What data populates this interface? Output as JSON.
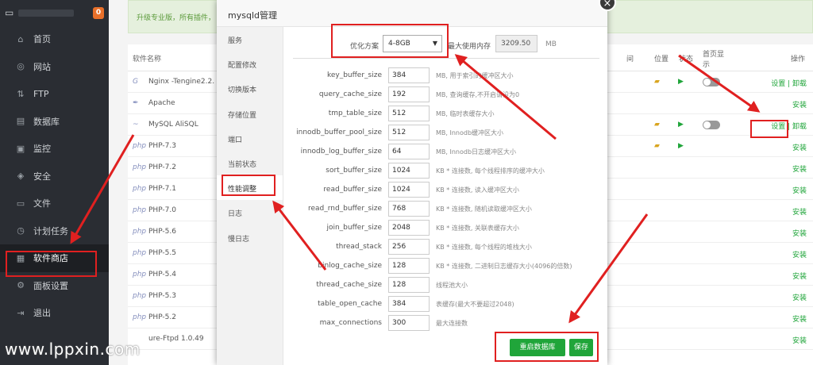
{
  "sidebar": {
    "badge": "0",
    "items": [
      {
        "label": "首页",
        "icon": "home-icon",
        "glyph": "⌂"
      },
      {
        "label": "网站",
        "icon": "globe-icon",
        "glyph": "◎"
      },
      {
        "label": "FTP",
        "icon": "ftp-icon",
        "glyph": "⇅"
      },
      {
        "label": "数据库",
        "icon": "database-icon",
        "glyph": "▤"
      },
      {
        "label": "监控",
        "icon": "monitor-icon",
        "glyph": "▣"
      },
      {
        "label": "安全",
        "icon": "shield-icon",
        "glyph": "◈"
      },
      {
        "label": "文件",
        "icon": "folder-icon",
        "glyph": "▭"
      },
      {
        "label": "计划任务",
        "icon": "clock-icon",
        "glyph": "◷"
      },
      {
        "label": "软件商店",
        "icon": "store-icon",
        "glyph": "▦"
      },
      {
        "label": "面板设置",
        "icon": "gear-icon",
        "glyph": "⚙"
      },
      {
        "label": "退出",
        "icon": "logout-icon",
        "glyph": "⇥"
      }
    ]
  },
  "promo": {
    "text": "升级专业版，所有插件，"
  },
  "table": {
    "headers": {
      "name": "软件名称",
      "time": "间",
      "pos": "位置",
      "status": "状态",
      "home1": "首页显",
      "home2": "示",
      "ops": "操作"
    },
    "rows": [
      {
        "logo": "G",
        "name": "Nginx -Tengine2.2.",
        "ops": "设置 | 卸载",
        "has_ctrl": true
      },
      {
        "logo": "✒",
        "name": "Apache",
        "ops": "安装",
        "has_ctrl": false
      },
      {
        "logo": "~",
        "name": "MySQL AliSQL",
        "ops": "设置 | 卸载",
        "has_ctrl": true
      },
      {
        "logo": "php",
        "name": "PHP-7.3",
        "ops": "安装",
        "has_ctrl": true
      },
      {
        "logo": "php",
        "name": "PHP-7.2",
        "ops": "安装",
        "has_ctrl": false
      },
      {
        "logo": "php",
        "name": "PHP-7.1",
        "ops": "安装",
        "has_ctrl": false
      },
      {
        "logo": "php",
        "name": "PHP-7.0",
        "ops": "安装",
        "has_ctrl": false
      },
      {
        "logo": "php",
        "name": "PHP-5.6",
        "ops": "安装",
        "has_ctrl": false
      },
      {
        "logo": "php",
        "name": "PHP-5.5",
        "ops": "安装",
        "has_ctrl": false
      },
      {
        "logo": "php",
        "name": "PHP-5.4",
        "ops": "安装",
        "has_ctrl": false
      },
      {
        "logo": "php",
        "name": "PHP-5.3",
        "ops": "安装",
        "has_ctrl": false
      },
      {
        "logo": "php",
        "name": "PHP-5.2",
        "ops": "安装",
        "has_ctrl": false
      },
      {
        "logo": "",
        "name": "ure-Ftpd 1.0.49",
        "ops": "安装",
        "has_ctrl": false
      }
    ]
  },
  "modal": {
    "title": "mysqld管理",
    "tabs": [
      "服务",
      "配置修改",
      "切换版本",
      "存储位置",
      "端口",
      "当前状态",
      "性能调整",
      "日志",
      "慢日志"
    ],
    "optimize_label": "优化方案",
    "optimize_value": "4-8GB",
    "max_mem_label": "最大使用内存",
    "max_mem_value": "3209.50",
    "max_mem_unit": "MB",
    "params": [
      {
        "key": "key_buffer_size",
        "value": "384",
        "desc": "MB, 用于索引的缓冲区大小"
      },
      {
        "key": "query_cache_size",
        "value": "192",
        "desc": "MB, 查询缓存,不开启请设为0"
      },
      {
        "key": "tmp_table_size",
        "value": "512",
        "desc": "MB, 临时表缓存大小"
      },
      {
        "key": "innodb_buffer_pool_size",
        "value": "512",
        "desc": "MB, Innodb缓冲区大小"
      },
      {
        "key": "innodb_log_buffer_size",
        "value": "64",
        "desc": "MB, Innodb日志缓冲区大小"
      },
      {
        "key": "sort_buffer_size",
        "value": "1024",
        "desc": "KB * 连接数, 每个线程排序的缓冲大小"
      },
      {
        "key": "read_buffer_size",
        "value": "1024",
        "desc": "KB * 连接数, 读入缓冲区大小"
      },
      {
        "key": "read_rnd_buffer_size",
        "value": "768",
        "desc": "KB * 连接数, 随机读取缓冲区大小"
      },
      {
        "key": "join_buffer_size",
        "value": "2048",
        "desc": "KB * 连接数, 关联表缓存大小"
      },
      {
        "key": "thread_stack",
        "value": "256",
        "desc": "KB * 连接数, 每个线程的堆栈大小"
      },
      {
        "key": "binlog_cache_size",
        "value": "128",
        "desc": "KB * 连接数, 二进制日志缓存大小(4096的倍数)"
      },
      {
        "key": "thread_cache_size",
        "value": "128",
        "desc": "线程池大小"
      },
      {
        "key": "table_open_cache",
        "value": "384",
        "desc": "表缓存(最大不要超过2048)"
      },
      {
        "key": "max_connections",
        "value": "300",
        "desc": "最大连接数"
      }
    ],
    "restart_label": "重启数据库",
    "save_label": "保存",
    "close_glyph": "×"
  },
  "watermark": "www.lppxin.com"
}
